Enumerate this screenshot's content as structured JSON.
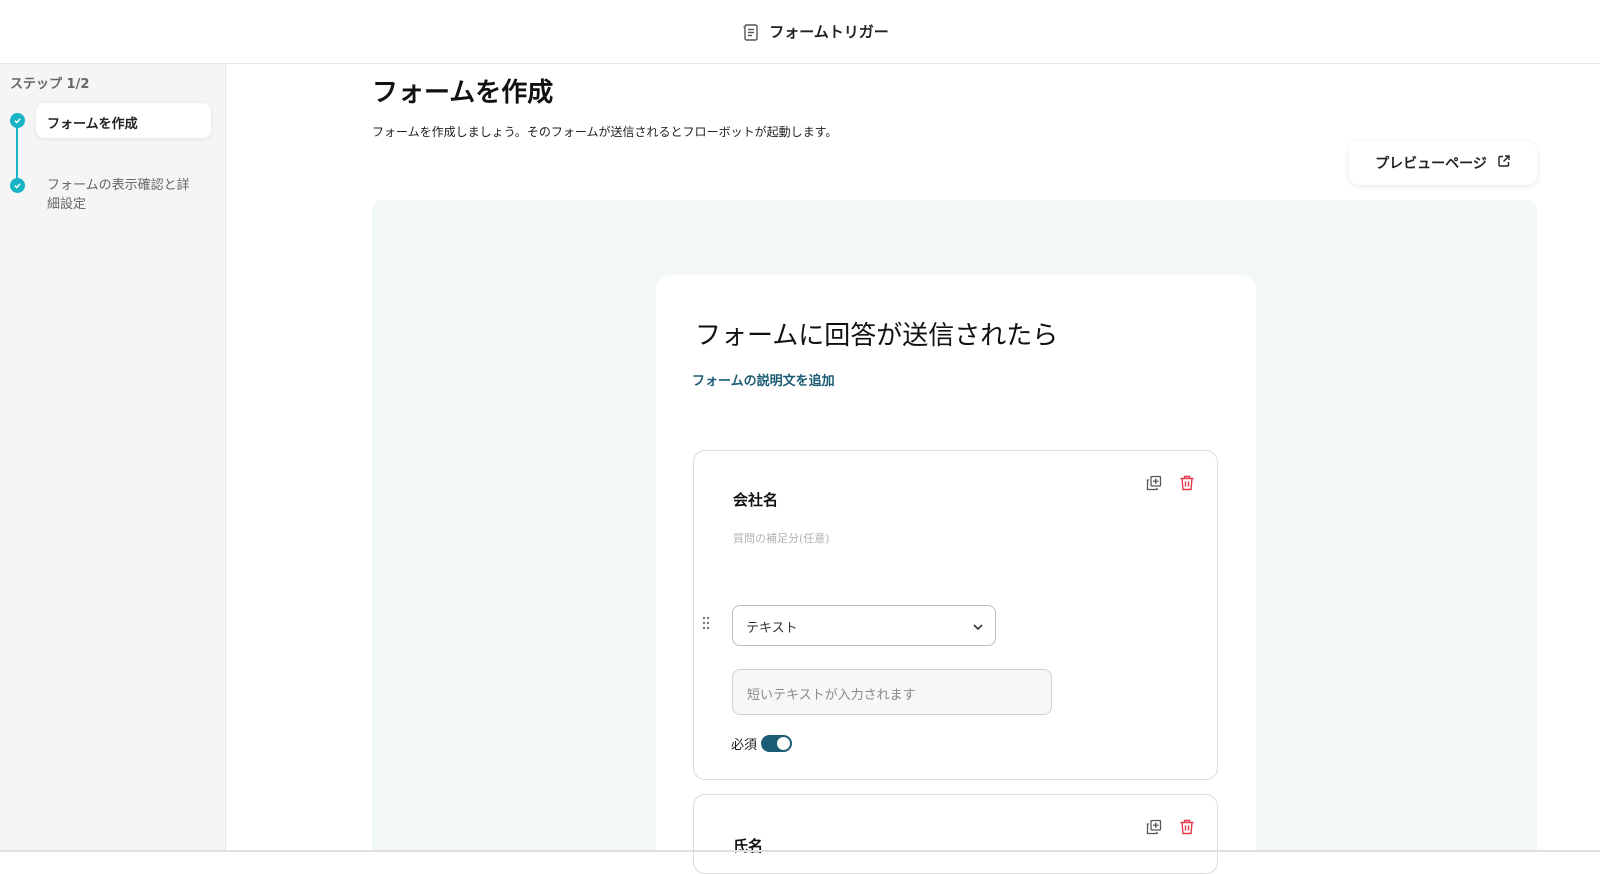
{
  "header": {
    "title": "フォームトリガー",
    "icon": "form-doc-icon"
  },
  "sidebar": {
    "step_label": "ステップ 1/2",
    "steps": [
      {
        "label": "フォームを作成",
        "status": "done",
        "active": true
      },
      {
        "label": "フォームの表示確認と詳細設定",
        "status": "done",
        "active": false
      }
    ]
  },
  "main": {
    "title": "フォームを作成",
    "description": "フォームを作成しましょう。そのフォームが送信されるとフローボットが起動します。",
    "preview_button": "プレビューページ"
  },
  "form": {
    "title": "フォームに回答が送信されたら",
    "add_description": "フォームの説明文を追加",
    "questions": [
      {
        "title": "会社名",
        "subtitle_placeholder": "質問の補足分(任意)",
        "type": "テキスト",
        "answer_placeholder": "短いテキストが入力されます",
        "required_label": "必須",
        "required": true
      },
      {
        "title": "氏名"
      }
    ]
  },
  "colors": {
    "accent": "#17b3c4",
    "primary": "#1b5b73",
    "delete": "#e0384a",
    "canvas": "#f1f8f7"
  }
}
